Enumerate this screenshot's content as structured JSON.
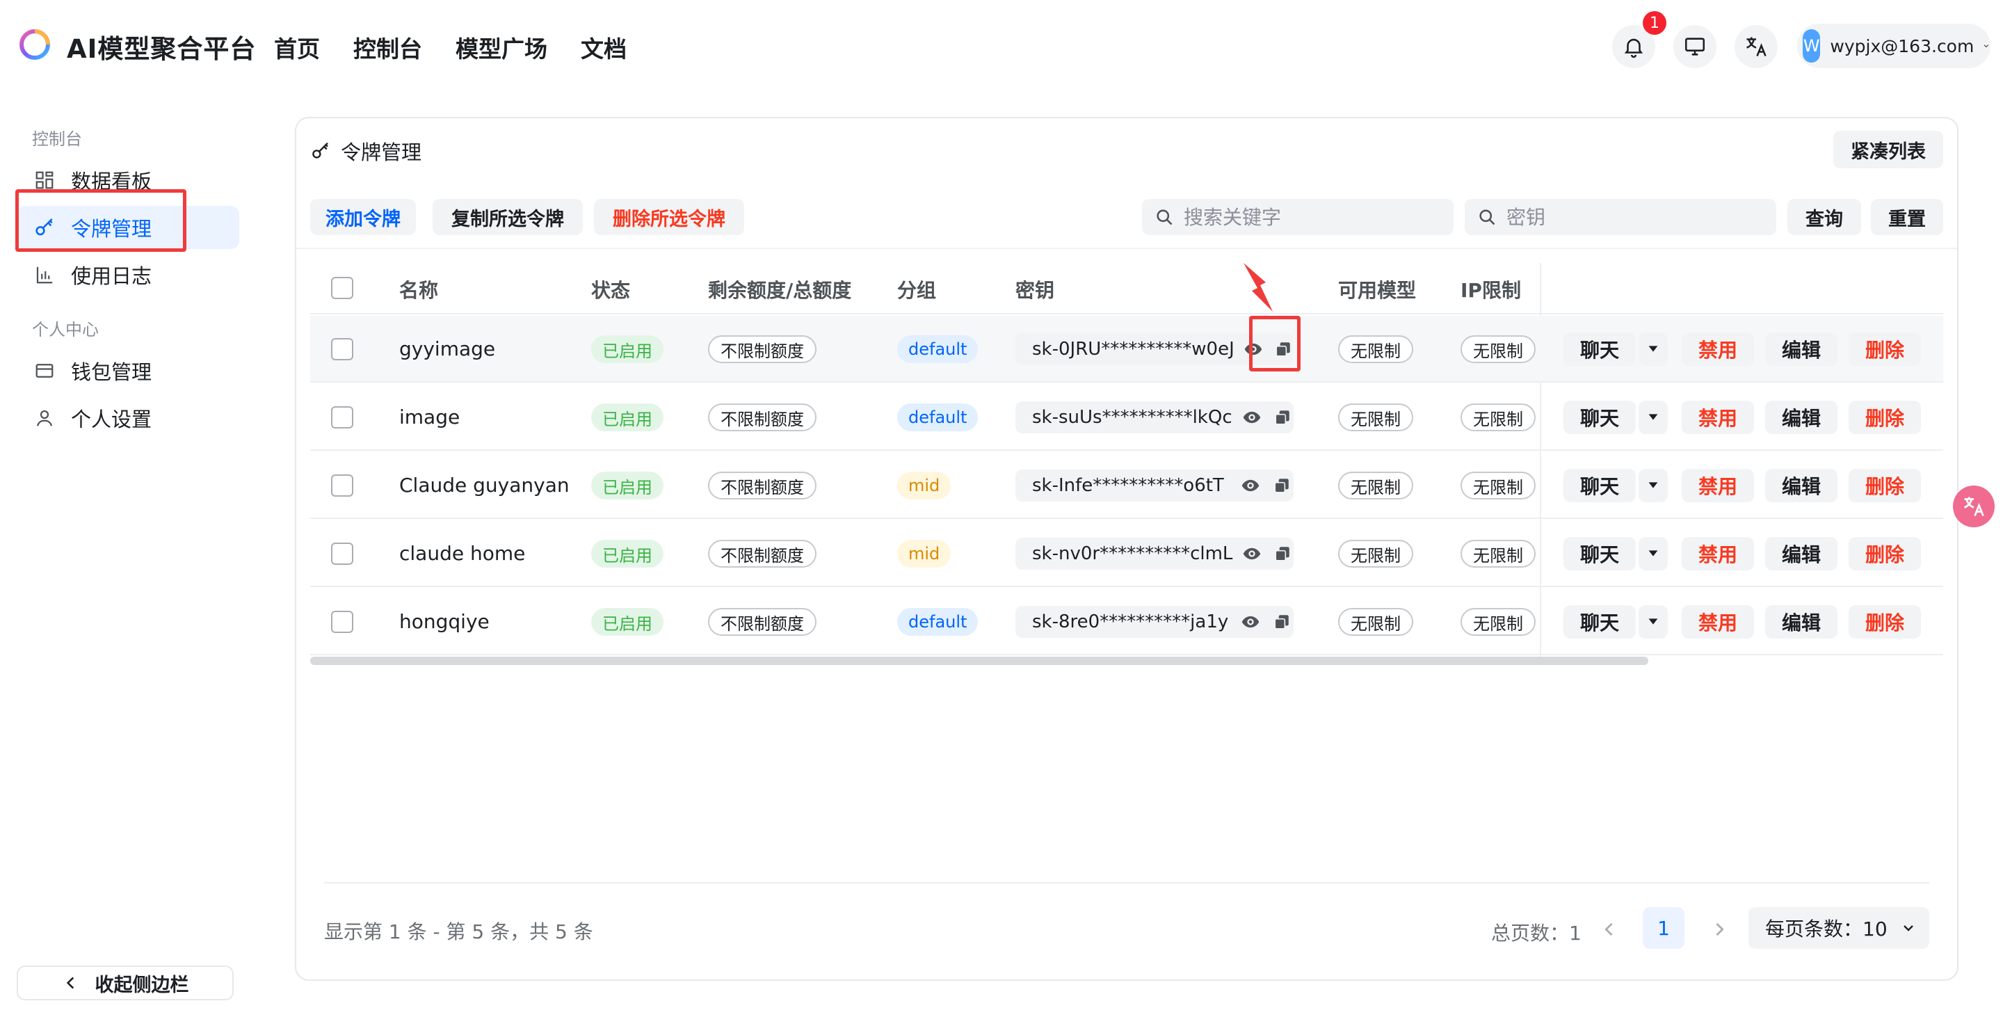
{
  "header": {
    "brand": "AI模型聚合平台",
    "nav": [
      "首页",
      "控制台",
      "模型广场",
      "文档"
    ],
    "notification_count": "1",
    "user": {
      "avatar_letter": "W",
      "email": "wypjx@163.com"
    }
  },
  "sidebar": {
    "section_console": "控制台",
    "section_personal": "个人中心",
    "items": [
      {
        "label": "数据看板",
        "icon": "grid-icon"
      },
      {
        "label": "令牌管理",
        "icon": "key-icon",
        "active": true
      },
      {
        "label": "使用日志",
        "icon": "bar-chart-icon"
      },
      {
        "label": "钱包管理",
        "icon": "wallet-icon"
      },
      {
        "label": "个人设置",
        "icon": "user-icon"
      }
    ],
    "collapse_label": "收起侧边栏"
  },
  "card": {
    "title": "令牌管理",
    "compact_label": "紧凑列表",
    "toolbar": {
      "add": "添加令牌",
      "copy_selected": "复制所选令牌",
      "delete_selected": "删除所选令牌",
      "search_keyword_placeholder": "搜索关键字",
      "search_key_placeholder": "密钥",
      "query": "查询",
      "reset": "重置"
    },
    "columns": [
      "名称",
      "状态",
      "剩余额度/总额度",
      "分组",
      "密钥",
      "可用模型",
      "IP限制"
    ],
    "rows": [
      {
        "name": "gyyimage",
        "status": "已启用",
        "quota": "不限制额度",
        "group": "default",
        "key": "sk-0JRU**********w0eJ",
        "models": "无限制",
        "ip": "无限制"
      },
      {
        "name": "image",
        "status": "已启用",
        "quota": "不限制额度",
        "group": "default",
        "key": "sk-suUs**********lkQc",
        "models": "无限制",
        "ip": "无限制"
      },
      {
        "name": "Claude guyanyan",
        "status": "已启用",
        "quota": "不限制额度",
        "group": "mid",
        "key": "sk-Infe**********o6tT",
        "models": "无限制",
        "ip": "无限制"
      },
      {
        "name": "claude home",
        "status": "已启用",
        "quota": "不限制额度",
        "group": "mid",
        "key": "sk-nv0r**********clmL",
        "models": "无限制",
        "ip": "无限制"
      },
      {
        "name": "hongqiye",
        "status": "已启用",
        "quota": "不限制额度",
        "group": "default",
        "key": "sk-8re0**********ja1y",
        "models": "无限制",
        "ip": "无限制"
      }
    ],
    "actions": {
      "chat": "聊天",
      "disable": "禁用",
      "edit": "编辑",
      "delete": "删除"
    },
    "footer": {
      "info": "显示第 1 条 - 第 5 条，共 5 条",
      "total_pages": "总页数：1",
      "current_page": "1",
      "page_size": "每页条数：10"
    }
  },
  "colors": {
    "accent": "#0064fa",
    "danger": "#f93920",
    "success": "#3bb346",
    "highlight": "#ef3b3b"
  }
}
